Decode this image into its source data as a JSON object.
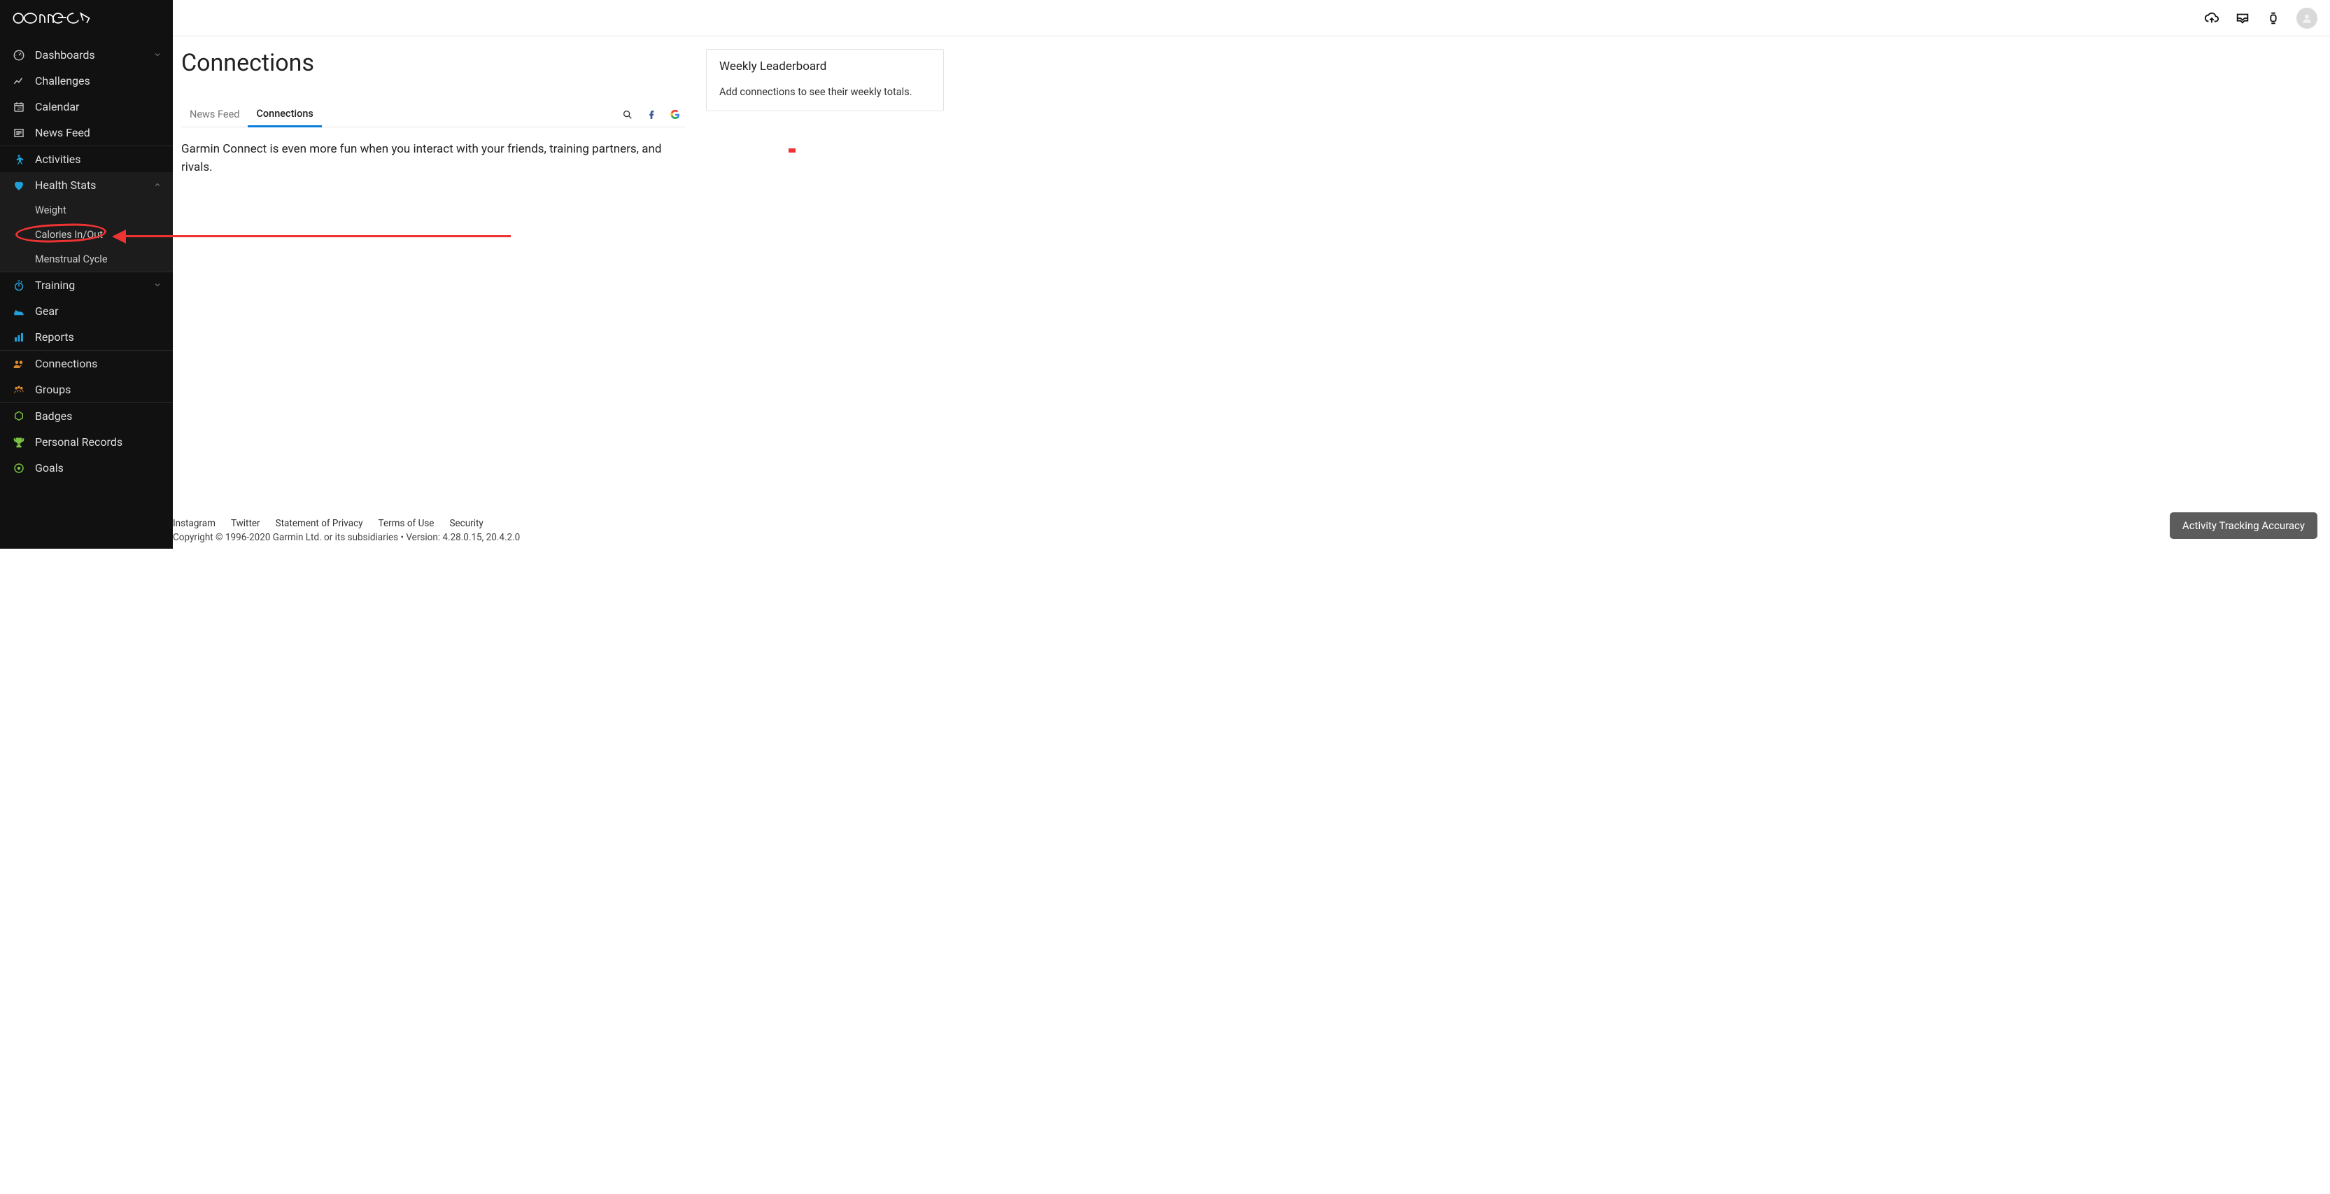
{
  "brand": "connect",
  "sidebar": {
    "items": {
      "dashboards": "Dashboards",
      "challenges": "Challenges",
      "calendar": "Calendar",
      "newsfeed": "News Feed",
      "activities": "Activities",
      "healthstats": "Health Stats",
      "hs_weight": "Weight",
      "hs_calories": "Calories In/Out",
      "hs_menstrual": "Menstrual Cycle",
      "training": "Training",
      "gear": "Gear",
      "reports": "Reports",
      "connections": "Connections",
      "groups": "Groups",
      "badges": "Badges",
      "personalrecords": "Personal Records",
      "goals": "Goals"
    }
  },
  "page": {
    "title": "Connections",
    "tabs": {
      "newsfeed": "News Feed",
      "connections": "Connections"
    },
    "description": "Garmin Connect is even more fun when you interact with your friends, training partners, and rivals."
  },
  "leaderboard": {
    "title": "Weekly Leaderboard",
    "body": "Add connections to see their weekly totals."
  },
  "footer": {
    "links": {
      "instagram": "Instagram",
      "twitter": "Twitter",
      "privacy": "Statement of Privacy",
      "terms": "Terms of Use",
      "security": "Security"
    },
    "copyright": "Copyright © 1996-2020 Garmin Ltd. or its subsidiaries • Version: 4.28.0.15, 20.4.2.0"
  },
  "accuracy_button": "Activity Tracking Accuracy",
  "icons": {
    "dashboard": "dashboard-icon",
    "challenges": "chart-line-icon",
    "calendar": "calendar-icon",
    "newsfeed": "news-icon",
    "activities": "person-icon",
    "health": "heart-icon",
    "training": "stopwatch-icon",
    "gear": "shoe-icon",
    "reports": "bar-chart-icon",
    "connections": "people-icon",
    "groups": "group-icon",
    "badges": "badge-icon",
    "records": "trophy-icon",
    "goals": "target-icon"
  },
  "colors": {
    "accent_blue": "#21a0d8",
    "accent_orange": "#d98a2e",
    "accent_green": "#7ac142",
    "annotation_red": "#e53e3e",
    "tab_active": "#0a7de0"
  }
}
